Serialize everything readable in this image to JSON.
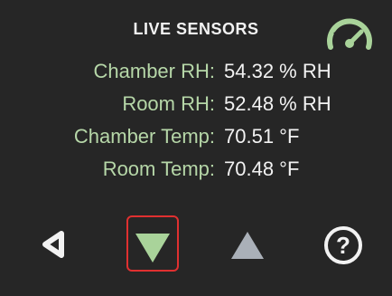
{
  "header": {
    "top_clipped_text": "...",
    "title": "LIVE SENSORS",
    "gauge_icon": "speedometer-icon"
  },
  "sensors": [
    {
      "label": "Chamber RH:",
      "value": "54.32 % RH"
    },
    {
      "label": "Room RH:",
      "value": "52.48 % RH"
    },
    {
      "label": "Chamber Temp:",
      "value": "70.51 °F"
    },
    {
      "label": "Room Temp:",
      "value": "70.48 °F"
    }
  ],
  "nav": {
    "back_icon": "back-triangle-icon",
    "down_icon": "down-triangle-icon",
    "up_icon": "up-triangle-icon",
    "help_icon": "help-circle-icon"
  },
  "colors": {
    "background": "#262626",
    "label": "#b6d7a8",
    "value": "#f2f2f2",
    "accent_green": "#a9d39a",
    "up_disabled": "#aab0b8",
    "selection_outline": "#e03030"
  }
}
